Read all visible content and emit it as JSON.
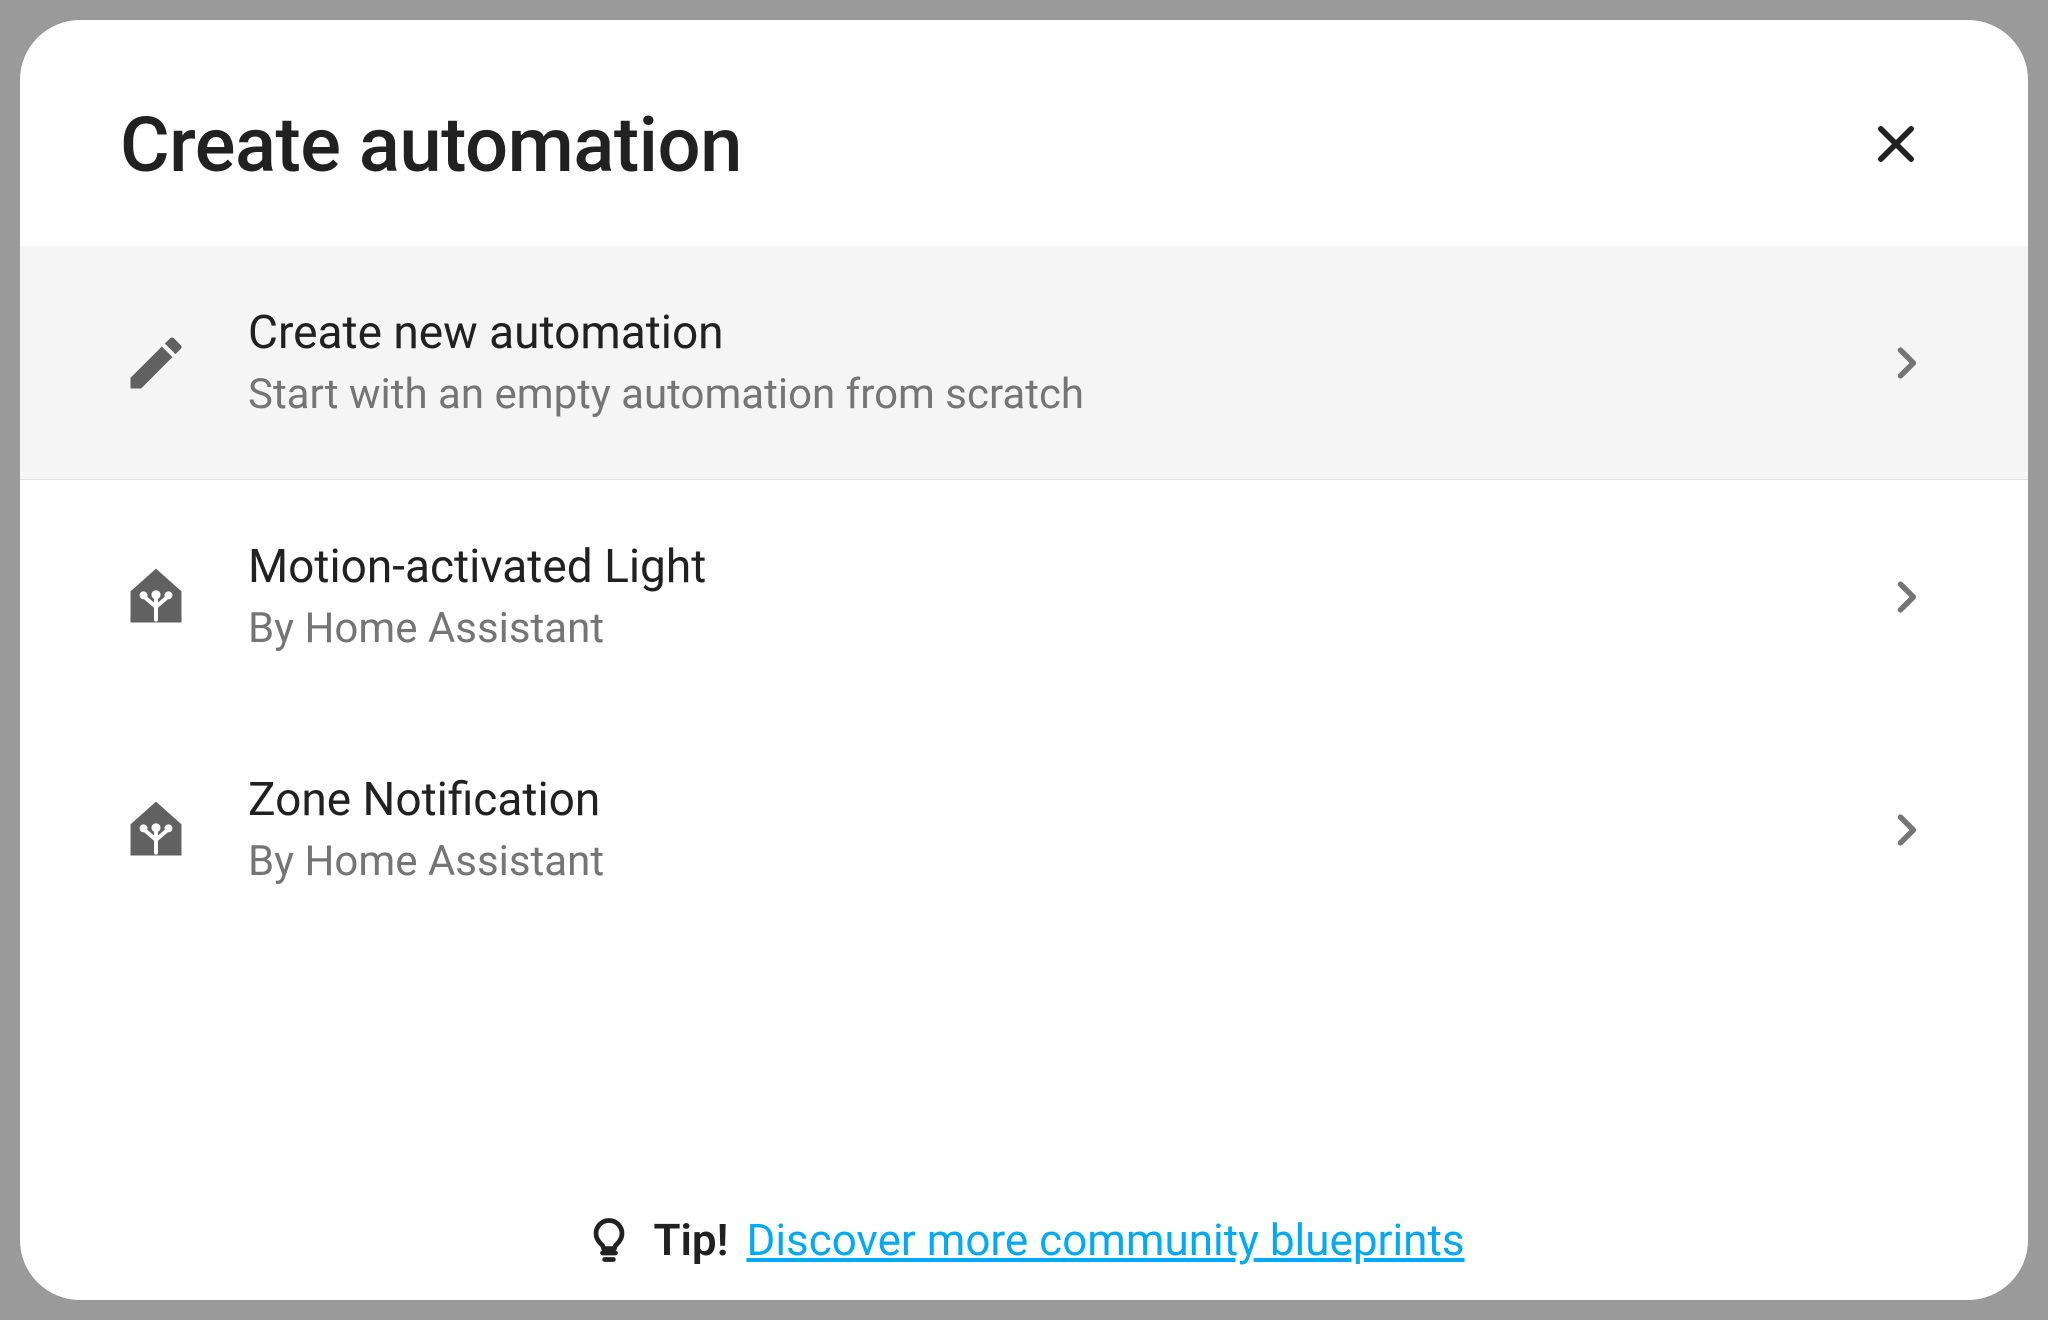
{
  "dialog": {
    "title": "Create automation"
  },
  "items": [
    {
      "icon": "pencil",
      "title": "Create new automation",
      "subtitle": "Start with an empty automation from scratch",
      "highlight": true
    },
    {
      "icon": "home-assistant",
      "title": "Motion-activated Light",
      "subtitle": "By Home Assistant",
      "highlight": false
    },
    {
      "icon": "home-assistant",
      "title": "Zone Notification",
      "subtitle": "By Home Assistant",
      "highlight": false
    }
  ],
  "tip": {
    "label": "Tip!",
    "link_text": "Discover more community blueprints"
  }
}
